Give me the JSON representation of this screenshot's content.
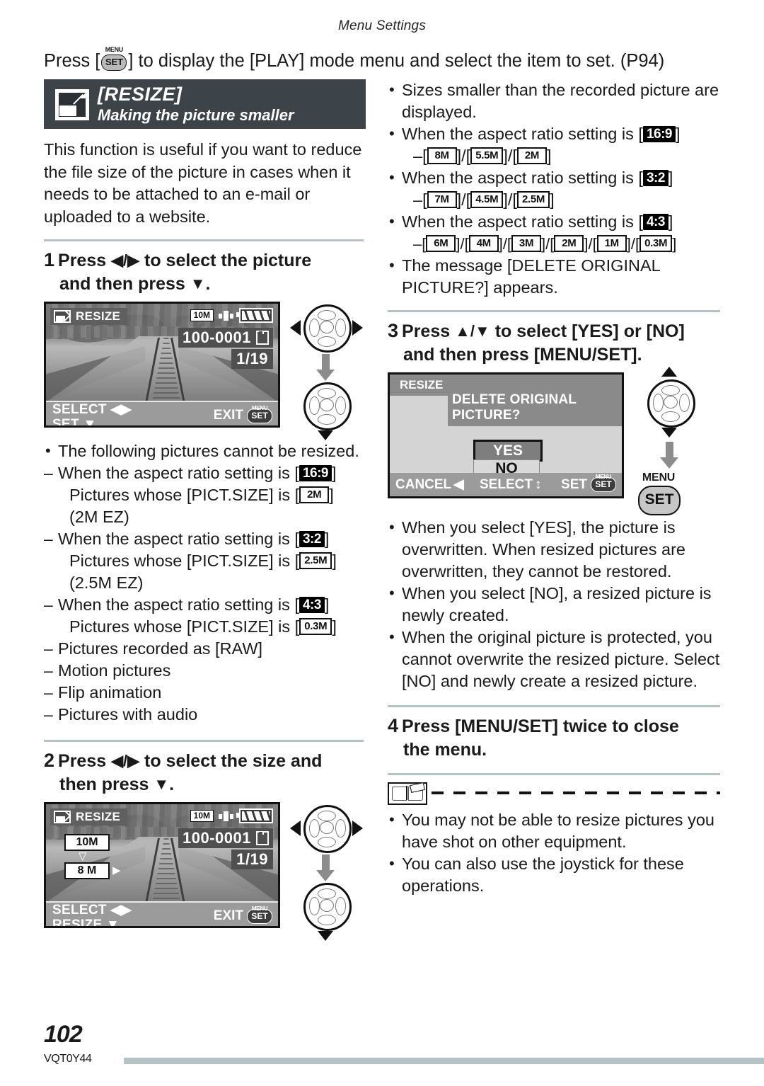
{
  "running_head": "Menu Settings",
  "intro": {
    "before": "Press [",
    "button_menu": "MENU",
    "button_set": "SET",
    "after": "] to display the [PLAY] mode menu and select the item to set. (P94)"
  },
  "banner": {
    "icon": "resize-icon",
    "title": "[RESIZE]",
    "subtitle": "Making the picture smaller"
  },
  "intro_paragraph": "This function is useful if you want to reduce the file size of the picture in cases when it needs to be attached to an e-mail or uploaded to a website.",
  "steps": {
    "one": {
      "number": "1",
      "line1_a": "Press ",
      "line1_arrows": "◀/▶",
      "line1_b": " to select the picture",
      "line2_a": "and then press ",
      "line2_arrow": "▼",
      "line2_b": "."
    },
    "two": {
      "number": "2",
      "line1_a": "Press ",
      "line1_arrows": "◀/▶",
      "line1_b": " to select the size and",
      "line2_a": "then press ",
      "line2_arrow": "▼",
      "line2_b": "."
    },
    "three": {
      "number": "3",
      "line1_a": "Press ",
      "line1_arrows": "▲/▼",
      "line1_b": " to select [YES] or [NO]",
      "line2": "and then press [MENU/SET]."
    },
    "four": {
      "number": "4",
      "line1": "Press [MENU/SET] twice to close",
      "line2": "the menu."
    }
  },
  "lcd1": {
    "title": "RESIZE",
    "pixel_badge": "10M",
    "file_number": "100-0001",
    "counter": "1/19",
    "footer_left_1": "SELECT",
    "footer_left_1_arrows": "◀▶",
    "footer_left_2": "SET",
    "footer_left_2_arrow": "▼",
    "footer_right": "EXIT",
    "footer_right_menu": "MENU",
    "footer_right_set": "SET"
  },
  "lcd2": {
    "title": "RESIZE",
    "pixel_badge": "10M",
    "file_number": "100-0001",
    "counter": "1/19",
    "size_current": "10M",
    "size_down_arrow": "▽",
    "size_target": "8 M",
    "size_right_arrow": "▶",
    "footer_left_1": "SELECT",
    "footer_left_1_arrows": "◀▶",
    "footer_left_2": "RESIZE",
    "footer_left_2_arrow": "▼",
    "footer_right": "EXIT",
    "footer_right_menu": "MENU",
    "footer_right_set": "SET"
  },
  "lcd3": {
    "title": "RESIZE",
    "message": "DELETE ORIGINAL PICTURE?",
    "option_yes": "YES",
    "option_no": "NO",
    "footer_cancel": "CANCEL",
    "footer_cancel_arrow": "◀",
    "footer_select": "SELECT",
    "footer_select_arrow": "↕",
    "footer_set": "SET",
    "footer_set_menu": "MENU",
    "footer_set_label": "SET"
  },
  "pad_labels": {
    "menu": "MENU",
    "set": "SET"
  },
  "left_notes": {
    "heading": "The following pictures cannot be resized.",
    "items": [
      {
        "dash_text_a": "When the aspect ratio setting is [",
        "badge": "16:9",
        "dash_text_b": "]",
        "cont1_a": "Pictures whose [PICT.SIZE] is [",
        "cont1_box": "2M",
        "cont1_b": "]",
        "cont2": "(2M EZ)"
      },
      {
        "dash_text_a": "When the aspect ratio setting is [",
        "badge": "3:2",
        "dash_text_b": "]",
        "cont1_a": "Pictures whose [PICT.SIZE] is [",
        "cont1_box": "2.5M",
        "cont1_b": "]",
        "cont2": "(2.5M EZ)"
      },
      {
        "dash_text_a": "When the aspect ratio setting is [",
        "badge": "4:3",
        "dash_text_b": "]",
        "cont1_a": "Pictures whose [PICT.SIZE] is [",
        "cont1_box": "0.3M",
        "cont1_b": "]",
        "cont2": ""
      }
    ],
    "simple": [
      "Pictures recorded as [RAW]",
      "Motion pictures",
      "Flip animation",
      "Pictures with audio"
    ]
  },
  "right_notes_top": {
    "b1": "Sizes smaller than the recorded picture are displayed.",
    "b2_a": "When the aspect ratio setting is [",
    "b2_badge": "16:9",
    "b2_b": "]",
    "b2_sizes": [
      "8M",
      "5.5M",
      "2M"
    ],
    "b3_a": "When the aspect ratio setting is [",
    "b3_badge": "3:2",
    "b3_b": "]",
    "b3_sizes": [
      "7M",
      "4.5M",
      "2.5M"
    ],
    "b4_a": "When the aspect ratio setting is [",
    "b4_badge": "4:3",
    "b4_b": "]",
    "b4_sizes": [
      "6M",
      "4M",
      "3M",
      "2M",
      "1M",
      "0.3M"
    ],
    "b5": "The message [DELETE ORIGINAL PICTURE?] appears."
  },
  "right_notes_mid": [
    "When you select [YES], the picture is overwritten. When resized pictures are overwritten, they cannot be restored.",
    "When you select [NO], a resized picture is newly created.",
    "When the original picture is protected, you cannot overwrite the resized picture. Select [NO] and newly create a resized picture."
  ],
  "note_block": [
    "You may not be able to resize pictures you have shot on other equipment.",
    "You can also use the joystick for these operations."
  ],
  "footer": {
    "page_number": "102",
    "model_code": "VQT0Y44"
  }
}
